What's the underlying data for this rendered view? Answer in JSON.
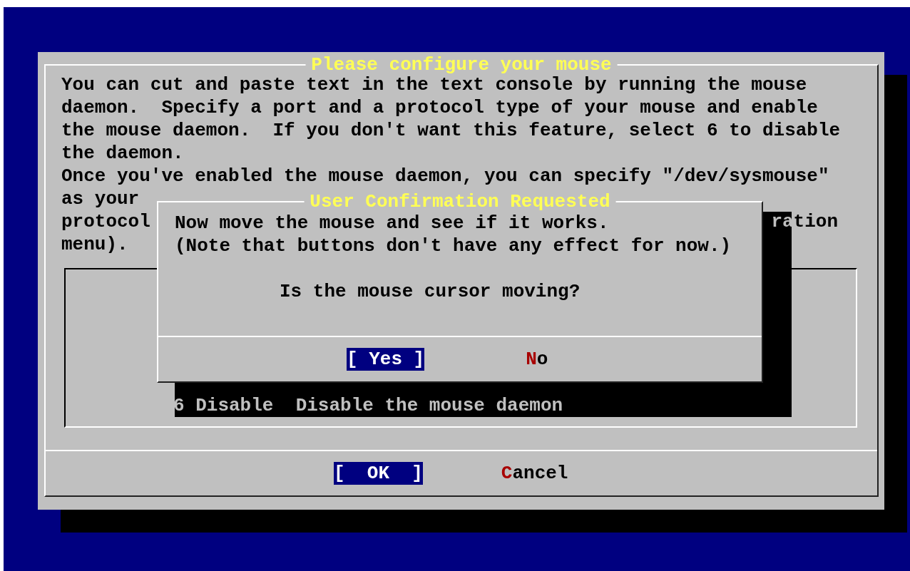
{
  "main_dialog": {
    "title": "Please configure your mouse",
    "intro": "You can cut and paste text in the text console by running the mouse daemon.  Specify a port and a protocol type of your mouse and enable the mouse daemon.  If you don't want this feature, select 6 to disable the daemon.",
    "text_line": "Once you've enabled the mouse daemon, you can specify \"/dev/sysmouse\"",
    "partial_lines": [
      {
        "left": "as your"
      },
      {
        "left": "protocol",
        "right": "ration"
      },
      {
        "left": "menu)."
      }
    ],
    "menu_items": [
      {
        "name": "6 Disable",
        "description": "Disable the mouse daemon"
      }
    ],
    "buttons": [
      {
        "label": "[  OK  ]",
        "selected": true
      },
      {
        "label": "Cancel",
        "selected": false
      }
    ]
  },
  "confirm_dialog": {
    "title": "User Confirmation Requested",
    "message_lines": [
      "Now move the mouse and see if it works.",
      "(Note that buttons don't have any effect for now.)"
    ],
    "question": "Is the mouse cursor moving?",
    "buttons": [
      {
        "label": "[ Yes ]",
        "selected": true
      },
      {
        "label": "No",
        "selected": false
      }
    ]
  }
}
